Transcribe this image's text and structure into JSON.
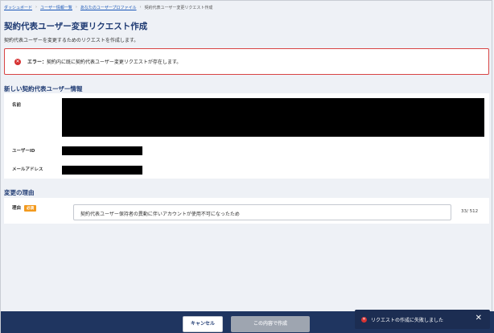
{
  "breadcrumb": [
    {
      "label": "ダッシュボード",
      "link": true
    },
    {
      "label": "ユーザー情報一覧",
      "link": true
    },
    {
      "label": "あなたのユーザープロファイル",
      "link": true
    },
    {
      "label": "契約代表ユーザー変更リクエスト作成",
      "link": false
    }
  ],
  "page": {
    "title": "契約代表ユーザー変更リクエスト作成",
    "description": "契約代表ユーザーを変更するためのリクエストを作成します。"
  },
  "error": {
    "icon": "error-icon",
    "prefix": "エラー：",
    "message": "契約内に既に契約代表ユーザー変更リクエストが存在します。"
  },
  "user_section": {
    "title": "新しい契約代表ユーザー情報",
    "fields": [
      {
        "label": "名前"
      },
      {
        "label": "ユーザーID"
      },
      {
        "label": "メールアドレス"
      }
    ]
  },
  "reason_section": {
    "title": "変更の理由",
    "label": "理由",
    "required_badge": "必須",
    "value": "契約代表ユーザー保持者の異動に伴いアカウントが使用不可になったため",
    "counter": "33/ 512"
  },
  "footer": {
    "cancel_label": "キャンセル",
    "submit_label": "この内容で作成"
  },
  "toast": {
    "message": "リクエストの作成に失敗しました"
  },
  "colors": {
    "accent": "#1f3b73",
    "error": "#d84444",
    "badge": "#f39a1e"
  }
}
